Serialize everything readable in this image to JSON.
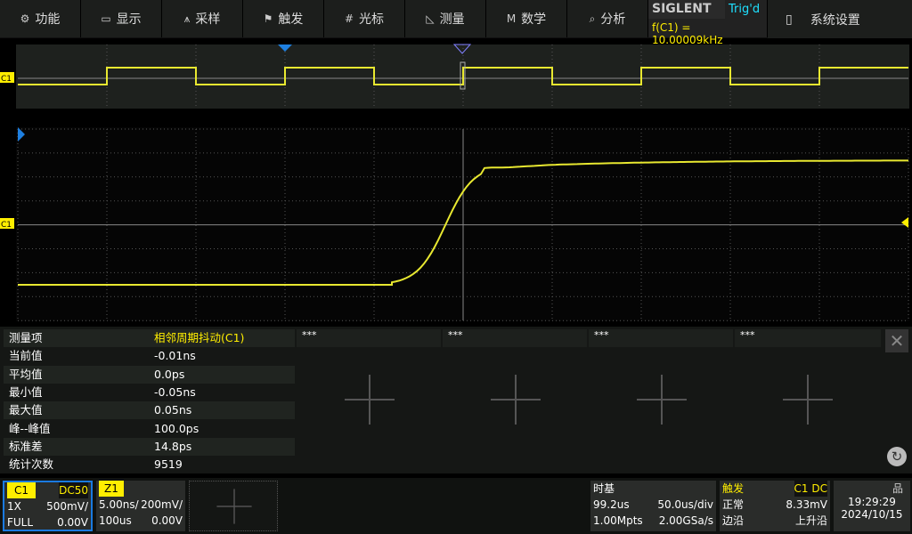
{
  "menu": [
    {
      "icon": "gear-icon",
      "glyph": "⚙",
      "label": "功能"
    },
    {
      "icon": "display-icon",
      "glyph": "▭",
      "label": "显示"
    },
    {
      "icon": "acquire-icon",
      "glyph": "⩚",
      "label": "采样"
    },
    {
      "icon": "flag-icon",
      "glyph": "⚑",
      "label": "触发"
    },
    {
      "icon": "cursor-icon",
      "glyph": "#",
      "label": "光标"
    },
    {
      "icon": "measure-icon",
      "glyph": "◺",
      "label": "测量"
    },
    {
      "icon": "math-icon",
      "glyph": "M",
      "label": "数学"
    },
    {
      "icon": "analyze-icon",
      "glyph": "⌕",
      "label": "分析"
    }
  ],
  "brand": {
    "logo": "SIGLENT",
    "trig_status": "Trig'd",
    "freq": "f(C1) = 10.00009kHz"
  },
  "system": {
    "icon": "battery-icon",
    "glyph": "▯",
    "label": "系统设置"
  },
  "channel_marker": "C1",
  "measure": {
    "rows": [
      [
        "测量项",
        "相邻周期抖动(C1)"
      ],
      [
        "当前值",
        "-0.01ns"
      ],
      [
        "平均值",
        "0.0ps"
      ],
      [
        "最小值",
        "-0.05ns"
      ],
      [
        "最大值",
        "0.05ns"
      ],
      [
        "峰--峰值",
        "100.0ps"
      ],
      [
        "标准差",
        "14.8ps"
      ],
      [
        "统计次数",
        "9519"
      ]
    ],
    "slots": [
      "***",
      "***",
      "***",
      "***"
    ]
  },
  "c1": {
    "name": "C1",
    "coupling": "DC50",
    "probe": "1X",
    "scale": "500mV/",
    "bw": "FULL",
    "offset": "0.00V"
  },
  "z1": {
    "name": "Z1",
    "tscale": "5.00ns/",
    "vscale": "200mV/",
    "delay": "100us",
    "offset": "0.00V"
  },
  "timebase": {
    "title": "时基",
    "delay": "99.2us",
    "scale": "50.0us/div",
    "mem": "1.00Mpts",
    "rate": "2.00GSa/s"
  },
  "trigger": {
    "title": "触发",
    "source": "C1 DC",
    "mode": "正常",
    "level": "8.33mV",
    "type": "边沿",
    "slope": "上升沿"
  },
  "clock": {
    "time": "19:29:29",
    "date": "2024/10/15"
  },
  "colors": {
    "trace": "#e8e830",
    "accent": "#0070d0",
    "yellow": "#ffee00"
  }
}
